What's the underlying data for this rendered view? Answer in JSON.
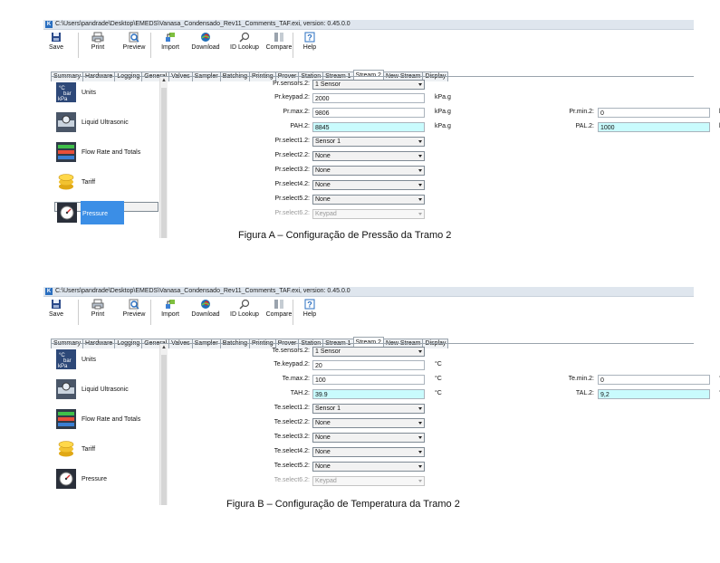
{
  "figure_a": {
    "window_title": "C:\\Users\\pandrade\\Desktop\\EMEDS\\Vanasa_Condensado_Rev11_Comments_TAF.exi, version: 0.45.0.0",
    "toolbar": [
      "Save",
      "Print",
      "Preview",
      "Import",
      "Download",
      "ID Lookup",
      "Compare",
      "Help"
    ],
    "tabs": [
      "Summary",
      "Hardware",
      "Logging",
      "General",
      "Valves",
      "Sampler",
      "Batching",
      "Printing",
      "Prover",
      "Station",
      "Stream 1",
      "Stream 2",
      "New Stream",
      "Display"
    ],
    "active_tab": "Stream 2",
    "sidebar": [
      {
        "label": "Units",
        "icon": "units-icon"
      },
      {
        "label": "Liquid Ultrasonic",
        "icon": "ultrasonic-meter-icon"
      },
      {
        "label": "Flow Rate and Totals",
        "icon": "flow-totals-icon"
      },
      {
        "label": "Tariff",
        "icon": "coins-icon"
      },
      {
        "label": "Pressure",
        "icon": "pressure-gauge-icon",
        "selected": true
      }
    ],
    "sensors_label": "Pr.sensors.2:",
    "sensors_value": "1 Sensor",
    "keypad_label": "Pr.keypad.2:",
    "keypad_value": "2000",
    "keypad_unit": "kPa.g",
    "max_label": "Pr.max.2:",
    "max_value": "9806",
    "max_unit": "kPa.g",
    "min_label": "Pr.min.2:",
    "min_value": "0",
    "min_unit": "kPa.g",
    "ah_label": "PAH.2:",
    "ah_value": "8845",
    "ah_unit": "kPa.g",
    "al_label": "PAL.2:",
    "al_value": "1000",
    "al_unit": "kPa.g",
    "selects": [
      {
        "label": "Pr.select1.2:",
        "value": "Sensor 1"
      },
      {
        "label": "Pr.select2.2:",
        "value": "None"
      },
      {
        "label": "Pr.select3.2:",
        "value": "None"
      },
      {
        "label": "Pr.select4.2:",
        "value": "None"
      },
      {
        "label": "Pr.select5.2:",
        "value": "None"
      },
      {
        "label": "Pr.select6.2:",
        "value": "Keypad",
        "disabled": true
      }
    ],
    "caption": "Figura A – Configuração de Pressão da Tramo 2"
  },
  "figure_b": {
    "window_title": "C:\\Users\\pandrade\\Desktop\\EMEDS\\Vanasa_Condensado_Rev11_Comments_TAF.exi, version: 0.45.0.0",
    "toolbar": [
      "Save",
      "Print",
      "Preview",
      "Import",
      "Download",
      "ID Lookup",
      "Compare",
      "Help"
    ],
    "tabs": [
      "Summary",
      "Hardware",
      "Logging",
      "General",
      "Valves",
      "Sampler",
      "Batching",
      "Printing",
      "Prover",
      "Station",
      "Stream 1",
      "Stream 2",
      "New Stream",
      "Display"
    ],
    "active_tab": "Stream 2",
    "sidebar": [
      {
        "label": "Units",
        "icon": "units-icon"
      },
      {
        "label": "Liquid Ultrasonic",
        "icon": "ultrasonic-meter-icon"
      },
      {
        "label": "Flow Rate and Totals",
        "icon": "flow-totals-icon"
      },
      {
        "label": "Tariff",
        "icon": "coins-icon"
      },
      {
        "label": "Pressure",
        "icon": "pressure-gauge-icon"
      }
    ],
    "sensors_label": "Te.sensors.2:",
    "sensors_value": "1 Sensor",
    "keypad_label": "Te.keypad.2:",
    "keypad_value": "20",
    "keypad_unit": "°C",
    "max_label": "Te.max.2:",
    "max_value": "100",
    "max_unit": "°C",
    "min_label": "Te.min.2:",
    "min_value": "0",
    "min_unit": "°C",
    "ah_label": "TAH.2:",
    "ah_value": "39.9",
    "ah_unit": "°C",
    "al_label": "TAL.2:",
    "al_value": "9,2",
    "al_unit": "°C",
    "selects": [
      {
        "label": "Te.select1.2:",
        "value": "Sensor 1"
      },
      {
        "label": "Te.select2.2:",
        "value": "None"
      },
      {
        "label": "Te.select3.2:",
        "value": "None"
      },
      {
        "label": "Te.select4.2:",
        "value": "None"
      },
      {
        "label": "Te.select5.2:",
        "value": "None"
      },
      {
        "label": "Te.select6.2:",
        "value": "Keypad",
        "disabled": true
      }
    ],
    "caption": "Figura B – Configuração de Temperatura da Tramo 2"
  },
  "colors": {
    "alarm_field": "#c9fbfd",
    "selected_item": "#3b8ee6",
    "accent": "#2a6fc0"
  }
}
